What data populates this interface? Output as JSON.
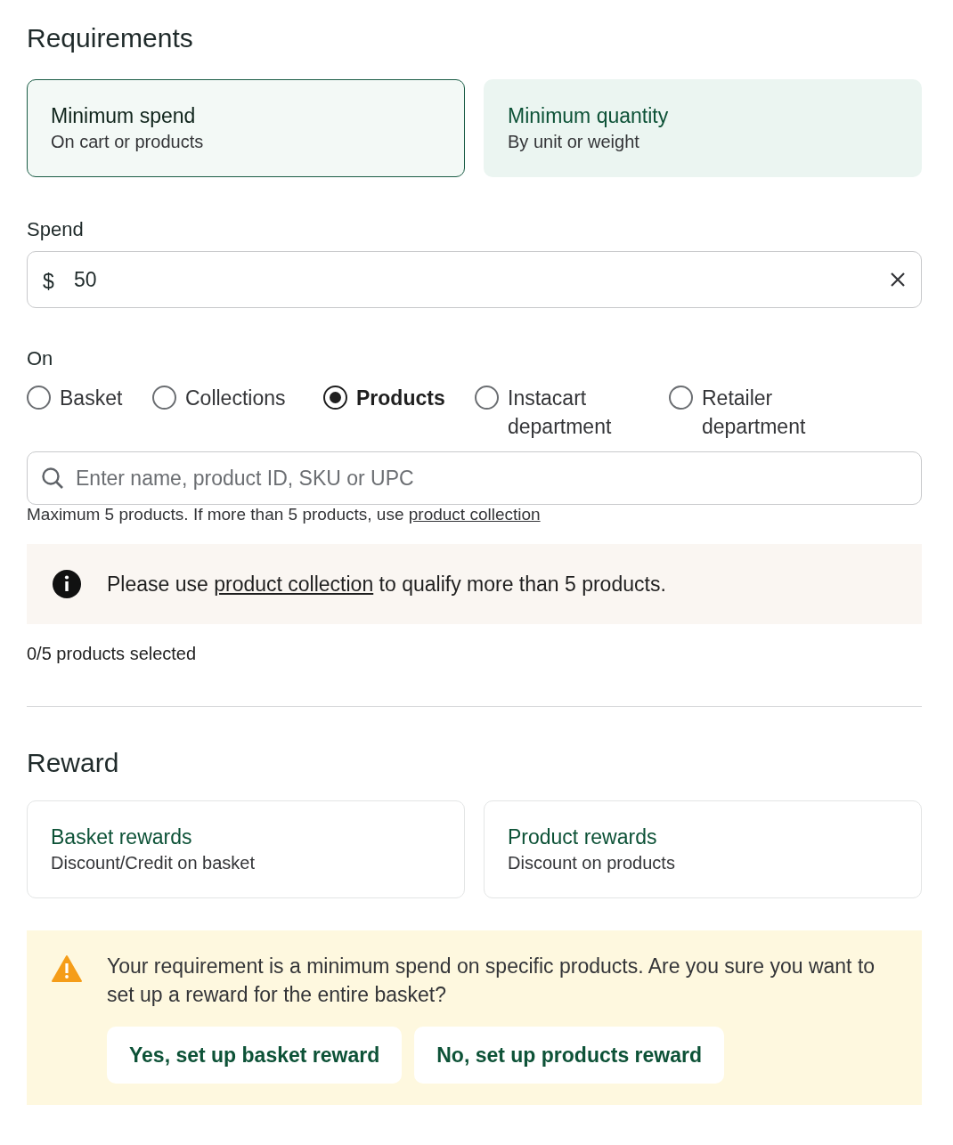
{
  "requirements": {
    "heading": "Requirements",
    "options": [
      {
        "title": "Minimum spend",
        "subtitle": "On cart or products",
        "selected": true
      },
      {
        "title": "Minimum quantity",
        "subtitle": "By unit or weight",
        "selected": false
      }
    ],
    "spend": {
      "label": "Spend",
      "prefix": "$",
      "value": "50"
    },
    "on": {
      "label": "On",
      "options": [
        {
          "label": "Basket",
          "selected": false
        },
        {
          "label": "Collections",
          "selected": false
        },
        {
          "label": "Products",
          "selected": true
        },
        {
          "label": "Instacart department",
          "selected": false
        },
        {
          "label": "Retailer department",
          "selected": false
        }
      ]
    },
    "search": {
      "placeholder": "Enter name, product ID, SKU or UPC"
    },
    "hint": {
      "before": "Maximum 5 products. If more than 5 products, use ",
      "link": "product collection"
    },
    "info": {
      "before": "Please use ",
      "link": "product collection",
      "after": " to qualify more than 5 products."
    },
    "count": "0/5 products selected"
  },
  "reward": {
    "heading": "Reward",
    "options": [
      {
        "title": "Basket rewards",
        "subtitle": "Discount/Credit on basket",
        "selected": false
      },
      {
        "title": "Product rewards",
        "subtitle": "Discount on products",
        "selected": false
      }
    ],
    "warning": {
      "text": "Your requirement is a minimum spend on specific products. Are you sure you want to set up a reward for the entire basket?",
      "buttons": [
        "Yes, set up basket reward",
        "No, set up products reward"
      ]
    }
  }
}
